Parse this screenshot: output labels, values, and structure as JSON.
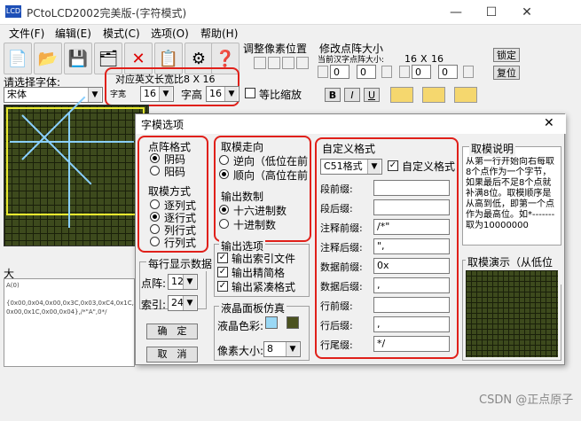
{
  "app": {
    "icon_text": "LCD",
    "title": "PCtoLCD2002完美版-(字符模式)"
  },
  "window_controls": {
    "minimize": "—",
    "maximize": "☐",
    "close": "✕"
  },
  "menu": [
    "文件(F)",
    "编辑(E)",
    "模式(C)",
    "选项(O)",
    "帮助(H)"
  ],
  "toolbar": {
    "adjust_pixel_label": "调整像素位置",
    "modify_dot_label": "修改点阵大小",
    "current_size_label": "当前汉字点阵大小:",
    "size_w": "16",
    "size_x": "X",
    "size_h": "16",
    "lock_btn": "锁定",
    "reset_btn": "复位",
    "spin1": "0",
    "spin2": "0",
    "spin3": "0",
    "spin4": "0"
  },
  "font_row": {
    "select_font_label": "请选择字体:",
    "font_value": "宋体",
    "width_hint": "对应英文长宽比8 X 16",
    "width_label": "字宽",
    "width_value": "16",
    "height_label": "字高",
    "height_value": "16",
    "proportional_label": "等比缩放",
    "bold": "B",
    "italic": "I",
    "underline": "U"
  },
  "left_panel": {
    "big_label": "大",
    "output_line1": "A(0)",
    "output_line2": "{0x00,0x04,0x00,0x3C,0x03,0xC4,0x1C,",
    "output_line3": "0x00,0x1C,0x00,0x04},/*\"A\",0*/"
  },
  "dialog": {
    "title": "字模选项",
    "close": "✕",
    "dot_format": {
      "title": "点阵格式",
      "options": [
        "阴码",
        "阳码"
      ],
      "selected": 0
    },
    "mode": {
      "title": "取模方式",
      "options": [
        "逐列式",
        "逐行式",
        "列行式",
        "行列式"
      ],
      "selected": 1
    },
    "direction": {
      "title": "取模走向",
      "options": [
        "逆向（低位在前",
        "顺向（高位在前"
      ],
      "selected": 1
    },
    "number_system": {
      "title": "输出数制",
      "options": [
        "十六进制数",
        "十进制数"
      ],
      "selected": 0
    },
    "output_options": {
      "title": "输出选项",
      "items": [
        "输出索引文件",
        "输出精简格",
        "输出紧凑格式"
      ],
      "checked": [
        true,
        true,
        true
      ]
    },
    "per_line": {
      "title": "每行显示数据",
      "dot_label": "点阵:",
      "dot_value": "12",
      "index_label": "索引:",
      "index_value": "24"
    },
    "ok": "确　定",
    "cancel": "取　消",
    "lcd_sim": {
      "title": "液晶面板仿真",
      "color_label": "液晶色彩:",
      "color1": "#9ad8f5",
      "color2": "#4b5220",
      "pixel_label": "像素大小:",
      "pixel_value": "8"
    },
    "custom": {
      "title": "自定义格式",
      "format_value": "C51格式",
      "custom_check_label": "自定义格式",
      "rows": [
        {
          "label": "段前缀:",
          "value": ""
        },
        {
          "label": "段后缀:",
          "value": ""
        },
        {
          "label": "注释前缀:",
          "value": "/*\""
        },
        {
          "label": "注释后缀:",
          "value": "\","
        },
        {
          "label": "数据前缀:",
          "value": "0x"
        },
        {
          "label": "数据后缀:",
          "value": ","
        },
        {
          "label": "行前缀:",
          "value": ""
        },
        {
          "label": "行后缀:",
          "value": ","
        },
        {
          "label": "行尾缀:",
          "value": "*/"
        }
      ]
    },
    "description": {
      "title": "取模说明",
      "text": "从第一行开始向右每取8个点作为一个字节，如果最后不足8个点就补满8位。取模顺序是从高到低，即第一个点作为最高位。如*-------取为10000000"
    },
    "demo_title": "取模演示（从低位到"
  },
  "watermark": "CSDN @正点原子"
}
